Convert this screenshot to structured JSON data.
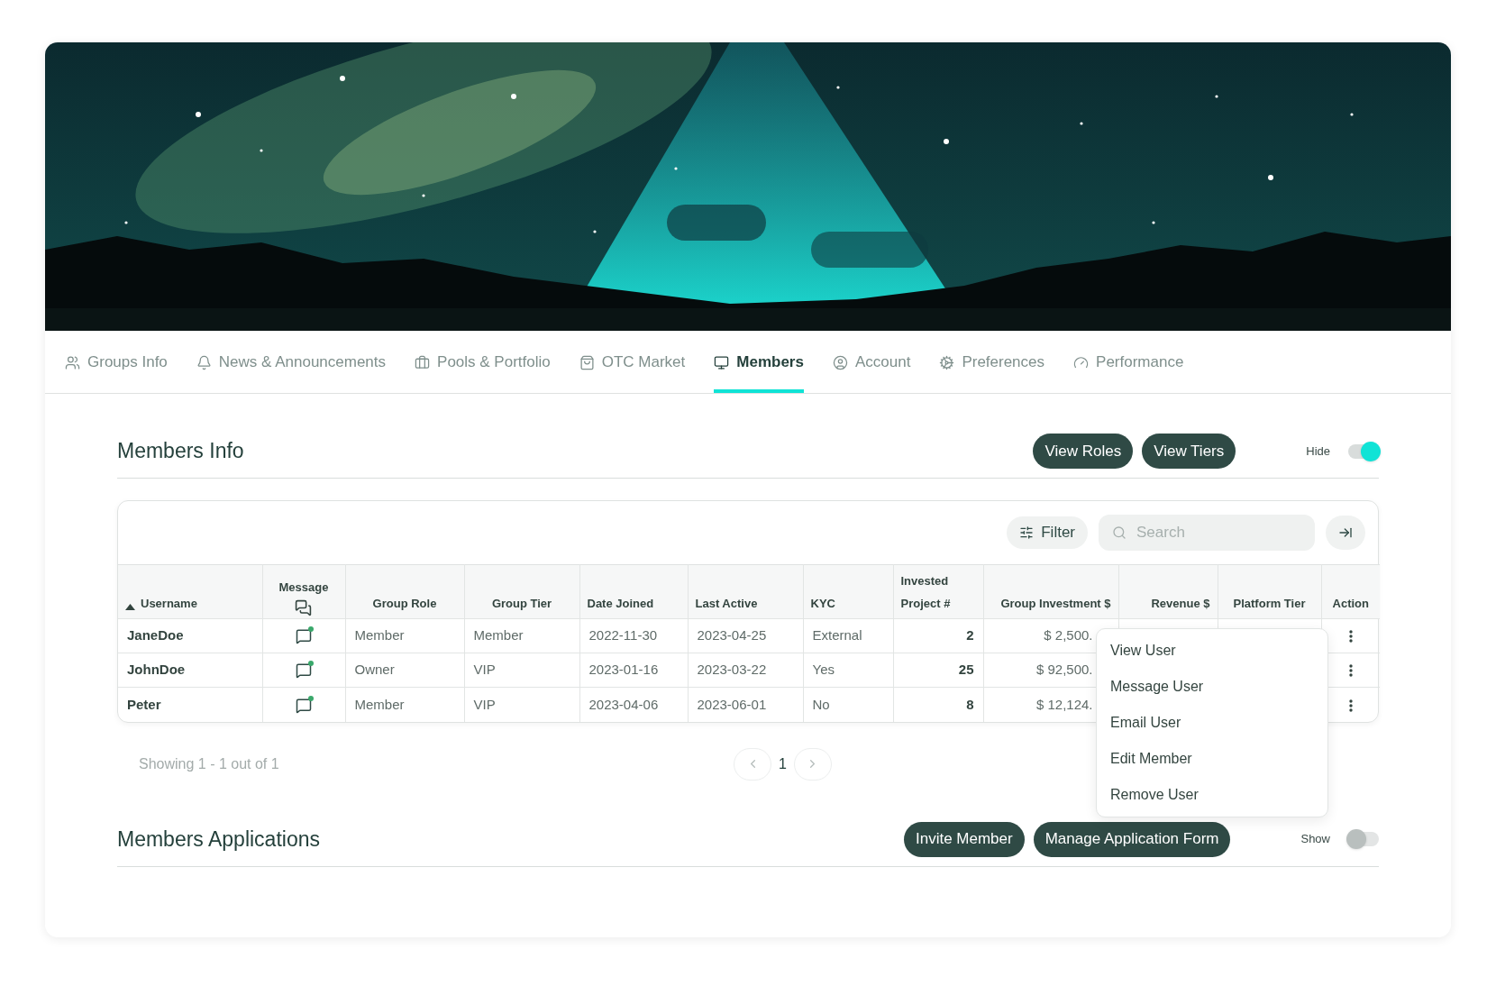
{
  "tabs": [
    {
      "label": "Groups Info",
      "selected": false
    },
    {
      "label": "News & Announcements",
      "selected": false
    },
    {
      "label": "Pools & Portfolio",
      "selected": false
    },
    {
      "label": "OTC Market",
      "selected": false
    },
    {
      "label": "Members",
      "selected": true
    },
    {
      "label": "Account",
      "selected": false
    },
    {
      "label": "Preferences",
      "selected": false
    },
    {
      "label": "Performance",
      "selected": false
    }
  ],
  "members_info": {
    "title": "Members Info",
    "buttons": [
      "View Roles",
      "View Tiers"
    ],
    "toggle": {
      "label": "Hide",
      "on": true
    }
  },
  "toolbar": {
    "filter": "Filter",
    "search": {
      "placeholder": "Search"
    }
  },
  "table": {
    "columns": [
      {
        "label": "Username",
        "sorted": true
      },
      {
        "label": "Message",
        "sorted": false
      },
      {
        "label": "Group Role",
        "sorted": false
      },
      {
        "label": "Group Tier",
        "sorted": false
      },
      {
        "label": "Date Joined",
        "sorted": false
      },
      {
        "label": "Last Active",
        "sorted": false
      },
      {
        "label": "KYC",
        "sorted": false
      },
      {
        "label": "Invested Project #",
        "sorted": false
      },
      {
        "label": "Group Investment  $",
        "sorted": false
      },
      {
        "label": "Revenue  $",
        "sorted": false
      },
      {
        "label": "Platform Tier",
        "sorted": false
      },
      {
        "label": "Action",
        "sorted": false
      }
    ],
    "rows": [
      {
        "username": "JaneDoe",
        "unread": true,
        "role": "Member",
        "tier": "Member",
        "joined": "2022-11-30",
        "active": "2023-04-25",
        "kyc": "External",
        "projects": "2",
        "investment": "$ 2,500."
      },
      {
        "username": "JohnDoe",
        "unread": true,
        "role": "Owner",
        "tier": "VIP",
        "joined": "2023-01-16",
        "active": "2023-03-22",
        "kyc": "Yes",
        "projects": "25",
        "investment": "$ 92,500."
      },
      {
        "username": "Peter",
        "unread": true,
        "role": "Member",
        "tier": "VIP",
        "joined": "2023-04-06",
        "active": "2023-06-01",
        "kyc": "No",
        "projects": "8",
        "investment": "$ 12,124."
      }
    ]
  },
  "action_menu": [
    "View User",
    "Message User",
    "Email User",
    "Edit Member",
    "Remove User"
  ],
  "pagination": {
    "summary": "Showing 1 - 1 out of 1",
    "pages": [
      {
        "label": "1",
        "selected": true
      }
    ]
  },
  "members_applications": {
    "title": "Members Applications",
    "buttons": [
      "Invite Member",
      "Manage Application Form"
    ],
    "toggle": {
      "label": "Show",
      "on": false
    }
  }
}
